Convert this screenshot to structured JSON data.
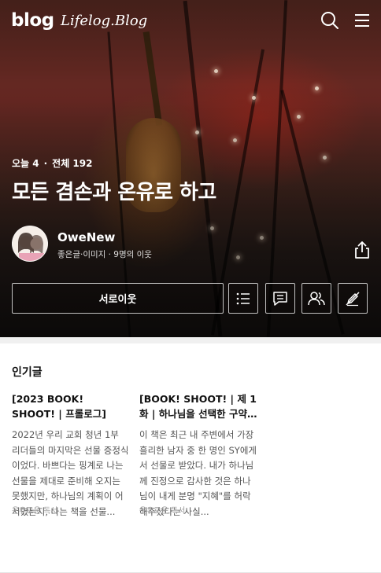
{
  "header": {
    "logo": "blog",
    "blog_logo_text": "Lifelog.Blog",
    "search_icon": "search-icon",
    "menu_icon": "menu-icon"
  },
  "hero": {
    "today_label": "오늘 4",
    "total_label": "전체 192",
    "separator": "·",
    "title": "모든 겸손과 온유로 하고"
  },
  "owner": {
    "name": "OweNew",
    "meta": "좋은글·이미지 · 9명의 이웃",
    "share_icon": "share-icon"
  },
  "actions": {
    "neighbor_button": "서로이웃",
    "icons": [
      "list-icon",
      "guestbook-icon",
      "neighbors-icon",
      "no-edit-icon"
    ]
  },
  "popular": {
    "title": "인기글",
    "posts": [
      {
        "title": "[2023 BOOK! SHOOT! | 프롤로그]",
        "excerpt": "2022년 우리 교회 청년 1부 리더들의 마지막은 선물 증정식이었다. 바쁘다는 핑계로 나는 선물을 제대로 준비해 오지는 못했지만, 하나님의 계획이 어서였는지, 나는 책을 선물...",
        "category": "온유로운 독서"
      },
      {
        "title": "[BOOK! SHOOT! | 제 1화 | 하나님을 선택한 구약의...",
        "excerpt": "이 책은 최근 내 주변에서 가장 흘리한 남자 중 한 명인 SY에게서 선물로 받았다. 내가 하나님께 진정으로 감사한 것은 하나님이 내게 분명 \"지혜\"를 허락해주셨다는 사실...",
        "category": "온유로운 독서"
      }
    ]
  }
}
